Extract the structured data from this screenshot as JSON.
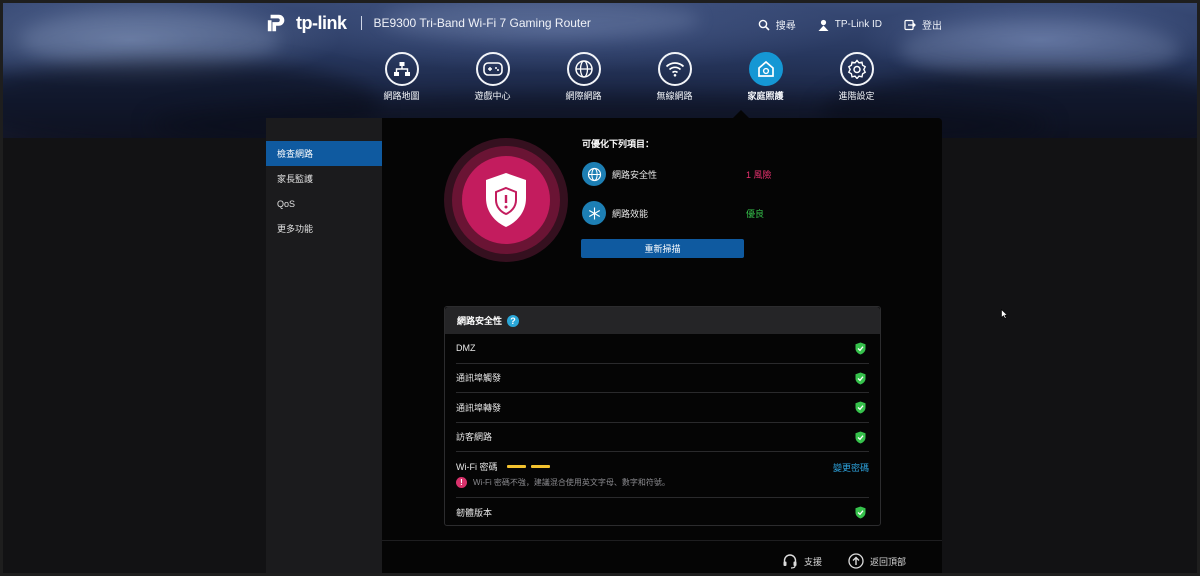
{
  "brand": {
    "logo_text": "tp-link",
    "product": "BE9300 Tri-Band Wi-Fi 7 Gaming Router"
  },
  "topnav": [
    {
      "label": "搜尋",
      "icon": "search-icon"
    },
    {
      "label": "TP-Link ID",
      "icon": "user-icon"
    },
    {
      "label": "登出",
      "icon": "logout-icon"
    }
  ],
  "mainnav": [
    {
      "label": "網路地圖",
      "icon": "network-map-icon",
      "active": false
    },
    {
      "label": "遊戲中心",
      "icon": "gamepad-icon",
      "active": false
    },
    {
      "label": "網際網路",
      "icon": "globe-icon",
      "active": false
    },
    {
      "label": "無線網路",
      "icon": "wifi-icon",
      "active": false
    },
    {
      "label": "家庭照護",
      "icon": "home-care-icon",
      "active": true
    },
    {
      "label": "進階設定",
      "icon": "gear-icon",
      "active": false
    }
  ],
  "sidebar": [
    {
      "label": "檢查網路",
      "active": true
    },
    {
      "label": "家長監護",
      "active": false
    },
    {
      "label": "QoS",
      "active": false
    },
    {
      "label": "更多功能",
      "active": false
    }
  ],
  "optimize": {
    "title": "可優化下列項目：",
    "items": [
      {
        "name": "網路安全性",
        "status": "1 風險",
        "status_type": "risk",
        "icon": "globe-icon"
      },
      {
        "name": "網路效能",
        "status": "優良",
        "status_type": "good",
        "icon": "snowflake-icon"
      }
    ],
    "rescan_label": "重新掃描"
  },
  "security_card": {
    "title": "網路安全性",
    "help": "?",
    "rows": [
      {
        "label": "DMZ",
        "ok": true
      },
      {
        "label": "通訊埠觸發",
        "ok": true
      },
      {
        "label": "通訊埠轉發",
        "ok": true
      },
      {
        "label": "訪客網路",
        "ok": true
      }
    ],
    "wifi_password": {
      "label": "Wi-Fi 密碼",
      "strength_bars": 2,
      "action": "變更密碼",
      "warning": "Wi-Fi 密碼不強，建議混合使用英文字母、數字和符號。",
      "warning_icon": "!"
    },
    "firmware": {
      "label": "韌體版本",
      "ok": true
    }
  },
  "footer": {
    "support": "支援",
    "back_to_top": "返回頂部"
  },
  "colors": {
    "accent": "#0f5aa0",
    "active_tab": "#1597d4",
    "risk": "#e8316f",
    "good": "#36c24c",
    "password_bar": "#f3c22f"
  }
}
